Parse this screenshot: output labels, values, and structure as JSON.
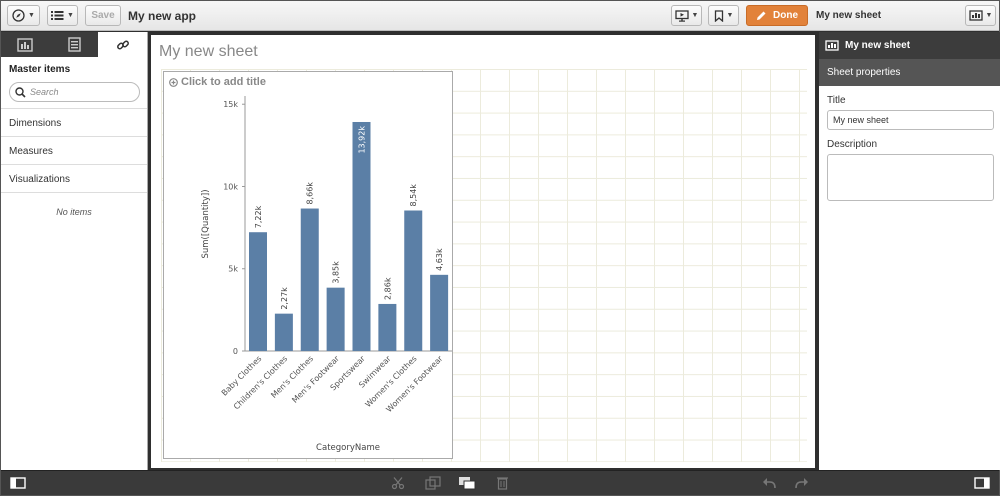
{
  "toolbar": {
    "save_label": "Save",
    "app_title": "My new app",
    "done_label": "Done",
    "sheet_name": "My new sheet"
  },
  "left_panel": {
    "tabs": [
      {
        "name": "charts-tab-icon"
      },
      {
        "name": "fields-tab-icon"
      },
      {
        "name": "master-items-tab-icon"
      }
    ],
    "title": "Master items",
    "search_placeholder": "Search",
    "sections": [
      "Dimensions",
      "Measures",
      "Visualizations"
    ],
    "empty_text": "No items"
  },
  "canvas": {
    "sheet_title": "My new sheet",
    "chart_title_placeholder": "Click to add title"
  },
  "chart_data": {
    "type": "bar",
    "orientation": "vertical",
    "categories": [
      "Baby Clothes",
      "Children's Clothes",
      "Men's Clothes",
      "Men's Footwear",
      "Sportswear",
      "Swimwear",
      "Women's Clothes",
      "Women's Footwear"
    ],
    "values": [
      7220,
      2270,
      8660,
      3850,
      13920,
      2860,
      8540,
      4630
    ],
    "data_labels": [
      "7,22k",
      "2,27k",
      "8,66k",
      "3,85k",
      "13,92k",
      "2,86k",
      "8,54k",
      "4,63k"
    ],
    "yticks": [
      0,
      5000,
      10000,
      15000
    ],
    "ytick_labels": [
      "0",
      "5k",
      "10k",
      "15k"
    ],
    "ylim": [
      0,
      15500
    ],
    "xlabel": "CategoryName",
    "ylabel": "Sum([Quantity])",
    "bar_color": "#5b7fa6",
    "grid": false
  },
  "right_panel": {
    "header": "My new sheet",
    "subheader": "Sheet properties",
    "title_label": "Title",
    "title_value": "My new sheet",
    "description_label": "Description",
    "description_value": ""
  },
  "colors": {
    "accent": "#e2823a",
    "dark_panel": "#3c3c3c",
    "grid_line": "#ecebdc"
  }
}
